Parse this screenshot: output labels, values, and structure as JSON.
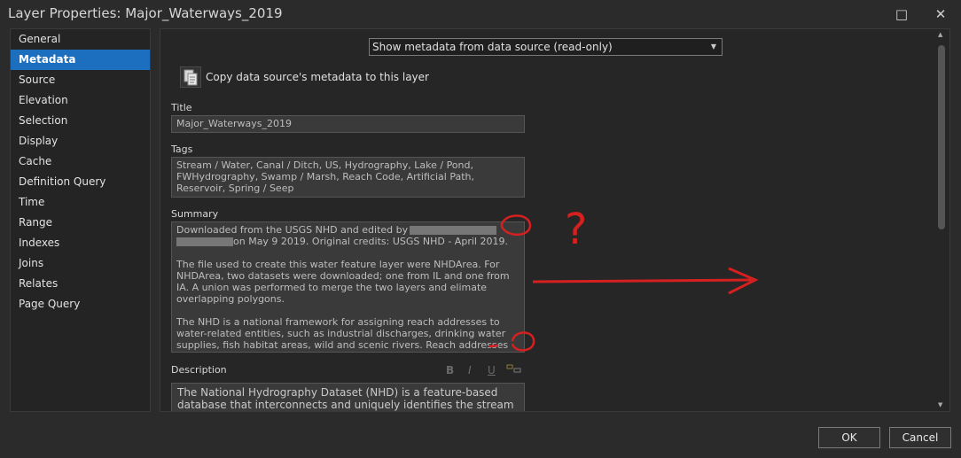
{
  "window": {
    "title": "Layer Properties: Major_Waterways_2019",
    "maximize_icon": "□",
    "close_icon": "✕"
  },
  "sidebar": {
    "items": [
      {
        "label": "General"
      },
      {
        "label": "Metadata"
      },
      {
        "label": "Source"
      },
      {
        "label": "Elevation"
      },
      {
        "label": "Selection"
      },
      {
        "label": "Display"
      },
      {
        "label": "Cache"
      },
      {
        "label": "Definition Query"
      },
      {
        "label": "Time"
      },
      {
        "label": "Range"
      },
      {
        "label": "Indexes"
      },
      {
        "label": "Joins"
      },
      {
        "label": "Relates"
      },
      {
        "label": "Page Query"
      }
    ],
    "active": "Metadata"
  },
  "metadata": {
    "source_select": "Show metadata from data source (read-only)",
    "copy_label": "Copy data source's metadata to this layer",
    "title_label": "Title",
    "title_value": "Major_Waterways_2019",
    "tags_label": "Tags",
    "tags_value": "Stream / Water, Canal / Ditch, US, Hydrography, Lake / Pond, FWHydrography, Swamp / Marsh, Reach Code, Artificial Path, Reservoir, Spring / Seep",
    "summary_label": "Summary",
    "summary_part1": "Downloaded from the USGS NHD and edited by",
    "summary_part2": "on May 9 2019. Original credits: USGS NHD - April 2019.",
    "summary_rest": "The file used to create this water feature layer were NHDArea. For NHDArea, two datasets were downloaded; one from IL and one from IA. A union was performed to merge the two layers and elimate overlapping polygons.\n\nThe NHD is a national framework for assigning reach addresses to water-related entities, such as industrial discharges, drinking water supplies, fish habitat areas, wild and scenic rivers. Reach addresses",
    "description_label": "Description",
    "description_value": "The National Hydrography Dataset (NHD) is a feature-based database that interconnects and uniquely identifies the stream segments or",
    "rte": {
      "bold": "B",
      "italic": "I",
      "underline": "U"
    }
  },
  "annotation": {
    "question_mark": "?"
  },
  "buttons": {
    "ok": "OK",
    "cancel": "Cancel"
  }
}
